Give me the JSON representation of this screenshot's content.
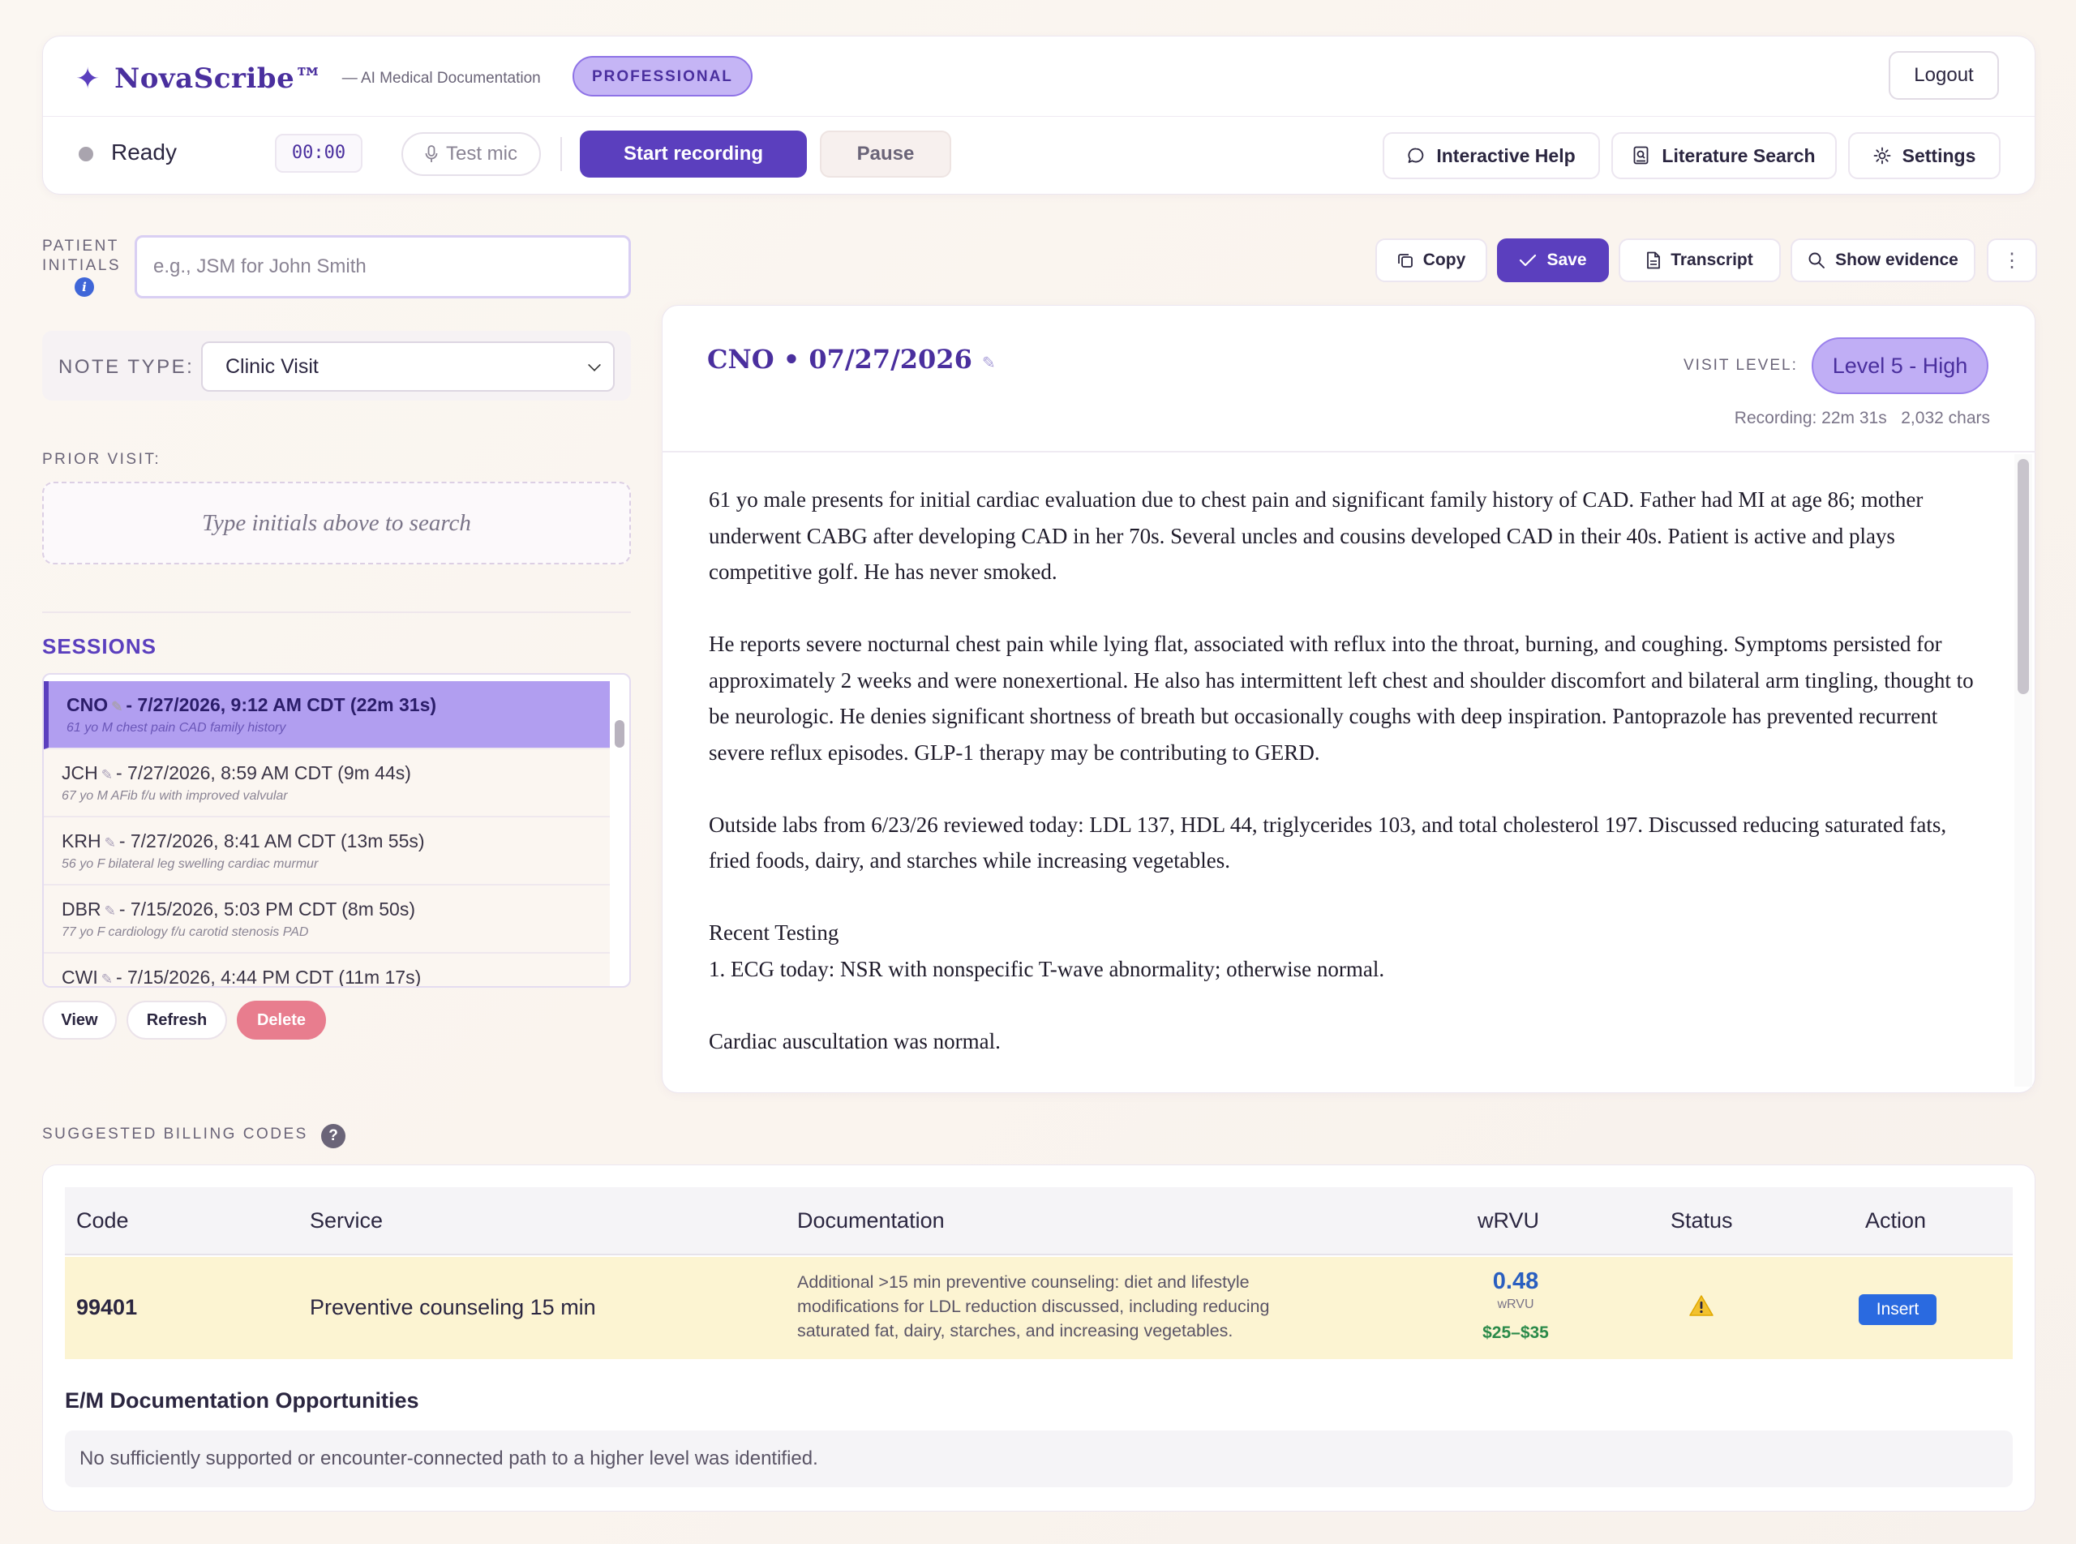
{
  "header": {
    "brand_star": "✦",
    "brand_name": "NovaScribe™",
    "brand_sub": "— AI Medical Documentation",
    "tier_badge": "PROFESSIONAL",
    "logout_label": "Logout"
  },
  "recorder": {
    "status": "Ready",
    "timer": "00:00",
    "test_mic_label": "Test mic",
    "start_label": "Start recording",
    "pause_label": "Pause"
  },
  "toolbar": {
    "help_label": "Interactive Help",
    "literature_label": "Literature Search",
    "settings_label": "Settings"
  },
  "patient": {
    "initials_label_line1": "PATIENT",
    "initials_label_line2": "INITIALS",
    "info_glyph": "i",
    "initials_placeholder": "e.g., JSM for John Smith",
    "initials_value": "",
    "note_type_label": "NOTE TYPE:",
    "note_type_value": "Clinic Visit",
    "prior_visit_label": "PRIOR VISIT:",
    "prior_visit_hint": "Type initials above to search"
  },
  "sessions": {
    "title": "SESSIONS",
    "items": [
      {
        "initials": "CNO",
        "detail": "- 7/27/2026, 9:12 AM CDT (22m 31s)",
        "summary": "61 yo M chest pain CAD family history"
      },
      {
        "initials": "JCH",
        "detail": "- 7/27/2026, 8:59 AM CDT (9m 44s)",
        "summary": "67 yo M AFib f/u with improved valvular"
      },
      {
        "initials": "KRH",
        "detail": "- 7/27/2026, 8:41 AM CDT (13m 55s)",
        "summary": "56 yo F bilateral leg swelling cardiac murmur"
      },
      {
        "initials": "DBR",
        "detail": "- 7/15/2026, 5:03 PM CDT (8m 50s)",
        "summary": "77 yo F cardiology f/u carotid stenosis PAD"
      },
      {
        "initials": "CWI",
        "detail": "- 7/15/2026, 4:44 PM CDT (11m 17s)",
        "summary": ""
      }
    ],
    "view_label": "View",
    "refresh_label": "Refresh",
    "delete_label": "Delete"
  },
  "note_actions": {
    "copy_label": "Copy",
    "save_label": "Save",
    "transcript_label": "Transcript",
    "evidence_label": "Show evidence",
    "more_glyph": "⋮"
  },
  "note": {
    "title": "CNO • 07/27/2026",
    "visit_level_label": "VISIT LEVEL:",
    "visit_level": "Level 5 - High",
    "recording_meta": "Recording: 22m 31s",
    "chars_meta": "2,032 chars",
    "paragraphs": [
      "61 yo male presents for initial cardiac evaluation due to chest pain and significant family history of CAD. Father had MI at age 86; mother underwent CABG after developing CAD in her 70s. Several uncles and cousins developed CAD in their 40s. Patient is active and plays competitive golf. He has never smoked.",
      "He reports severe nocturnal chest pain while lying flat, associated with reflux into the throat, burning, and coughing. Symptoms persisted for approximately 2 weeks and were nonexertional. He also has intermittent left chest and shoulder discomfort and bilateral arm tingling, thought to be neurologic. He denies significant shortness of breath but occasionally coughs with deep inspiration. Pantoprazole has prevented recurrent severe reflux episodes. GLP-1 therapy may be contributing to GERD.",
      "Outside labs from 6/23/26 reviewed today: LDL 137, HDL 44, triglycerides 103, and total cholesterol 197. Discussed reducing saturated fats, fried foods, dairy, and starches while increasing vegetables.",
      "Recent Testing",
      "1. ECG today: NSR with nonspecific T-wave abnormality; otherwise normal.",
      "Cardiac auscultation was normal."
    ]
  },
  "billing": {
    "section_label": "SUGGESTED BILLING CODES",
    "help_glyph": "?",
    "columns": [
      "Code",
      "Service",
      "Documentation",
      "wRVU",
      "Status",
      "Action"
    ],
    "rows": [
      {
        "code": "99401",
        "service": "Preventive counseling 15 min",
        "documentation": "Additional >15 min preventive counseling: diet and lifestyle modifications for LDL reduction discussed, including reducing saturated fat, dairy, starches, and increasing vegetables.",
        "wrvu": "0.48",
        "wrvu_unit": "wRVU",
        "price": "$25–$35",
        "status_icon": "warning-icon",
        "action_label": "Insert"
      }
    ],
    "em_title": "E/M Documentation Opportunities",
    "em_message": "No sufficiently supported or encounter-connected path to a higher level was identified."
  },
  "colors": {
    "brand": "#5b3fbe",
    "active_session": "#b19ef0",
    "delete": "#e87d8e",
    "insert": "#2a6ae0",
    "row_highlight": "#fcf4d2"
  }
}
